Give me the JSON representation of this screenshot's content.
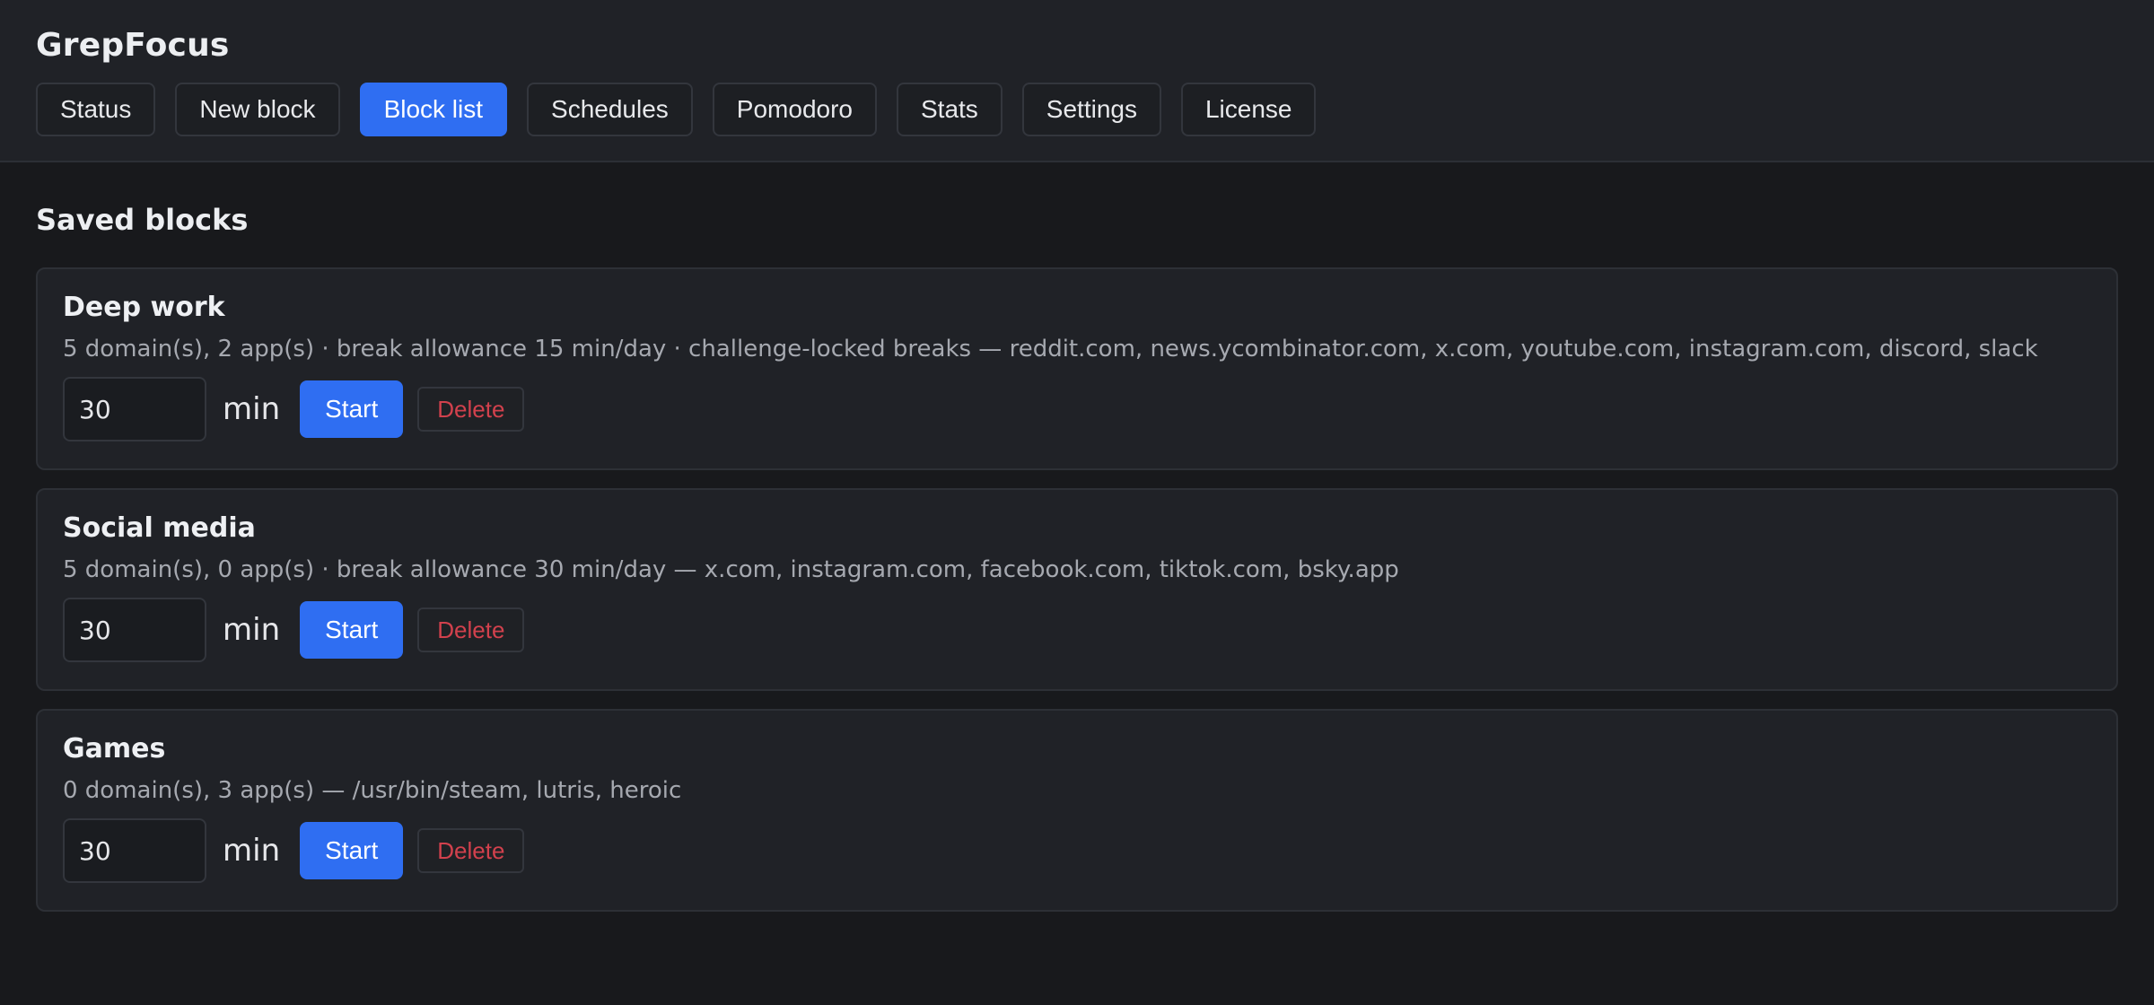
{
  "app": {
    "title": "GrepFocus"
  },
  "tabs": [
    {
      "label": "Status",
      "active": false
    },
    {
      "label": "New block",
      "active": false
    },
    {
      "label": "Block list",
      "active": true
    },
    {
      "label": "Schedules",
      "active": false
    },
    {
      "label": "Pomodoro",
      "active": false
    },
    {
      "label": "Stats",
      "active": false
    },
    {
      "label": "Settings",
      "active": false
    },
    {
      "label": "License",
      "active": false
    }
  ],
  "main": {
    "section_title": "Saved blocks",
    "unit_label": "min",
    "start_label": "Start",
    "delete_label": "Delete",
    "blocks": [
      {
        "name": "Deep work",
        "description": "5 domain(s), 2 app(s) · break allowance 15 min/day · challenge-locked breaks — reddit.com, news.ycombinator.com, x.com, youtube.com, instagram.com, discord, slack",
        "duration": "30"
      },
      {
        "name": "Social media",
        "description": "5 domain(s), 0 app(s) · break allowance 30 min/day — x.com, instagram.com, facebook.com, tiktok.com, bsky.app",
        "duration": "30"
      },
      {
        "name": "Games",
        "description": "0 domain(s), 3 app(s) — /usr/bin/steam, lutris, heroic",
        "duration": "30"
      }
    ]
  },
  "colors": {
    "accent": "#2f6ef2",
    "danger": "#d2414d",
    "background": "#18191c",
    "surface": "#202227"
  }
}
